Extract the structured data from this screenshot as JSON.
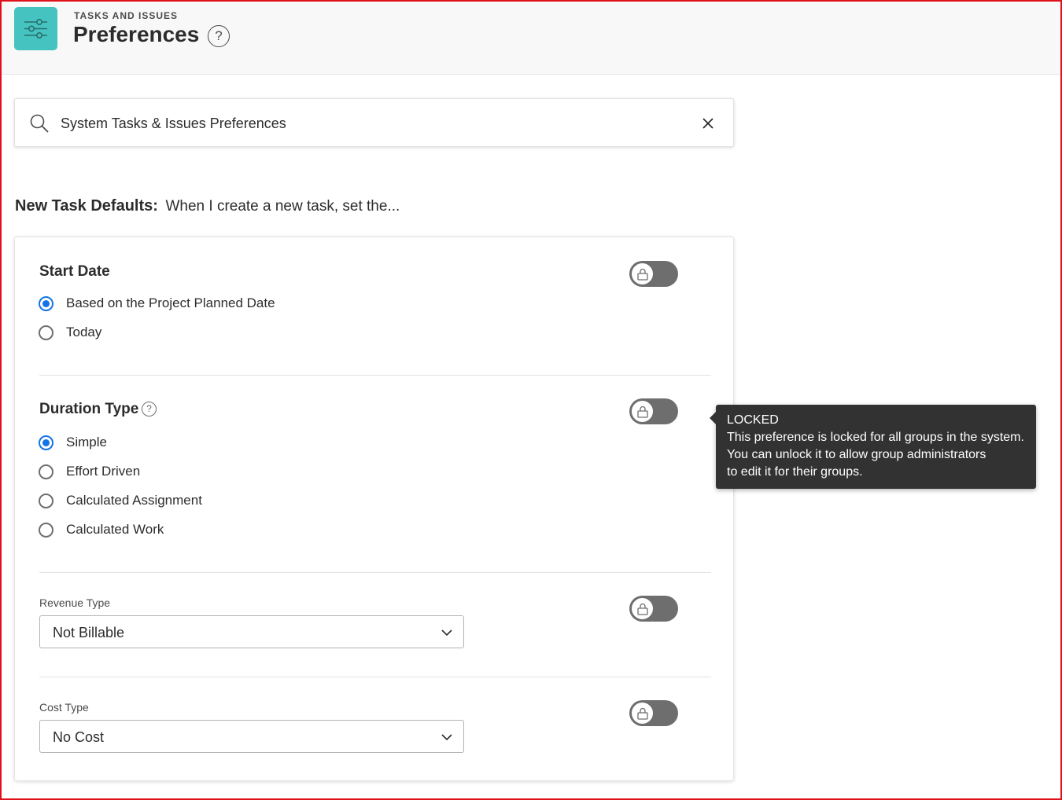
{
  "header": {
    "breadcrumb": "TASKS AND ISSUES",
    "title": "Preferences",
    "help_symbol": "?",
    "app_icon": "sliders-icon",
    "accent_color": "#45c3c0"
  },
  "search": {
    "value": "System Tasks & Issues Preferences",
    "placeholder": "Search"
  },
  "section": {
    "heading": "New Task Defaults:",
    "subheading": "When I create a new task, set the..."
  },
  "preferences": {
    "start_date": {
      "title": "Start Date",
      "options": [
        {
          "label": "Based on the Project Planned Date",
          "selected": true
        },
        {
          "label": "Today",
          "selected": false
        }
      ],
      "locked": true
    },
    "duration_type": {
      "title": "Duration Type",
      "help_symbol": "?",
      "options": [
        {
          "label": "Simple",
          "selected": true
        },
        {
          "label": "Effort Driven",
          "selected": false
        },
        {
          "label": "Calculated Assignment",
          "selected": false
        },
        {
          "label": "Calculated Work",
          "selected": false
        }
      ],
      "locked": true
    },
    "revenue_type": {
      "label": "Revenue Type",
      "value": "Not Billable",
      "locked": true
    },
    "cost_type": {
      "label": "Cost Type",
      "value": "No Cost",
      "locked": true
    }
  },
  "tooltip": {
    "title": "LOCKED",
    "line1": "This preference is locked for all groups in the system.",
    "line2": "You can unlock it to allow group administrators",
    "line3": "to edit it for their groups."
  },
  "colors": {
    "radio_selected": "#1473e6",
    "toggle_locked": "#6e6e6e",
    "tooltip_bg": "#323232"
  }
}
